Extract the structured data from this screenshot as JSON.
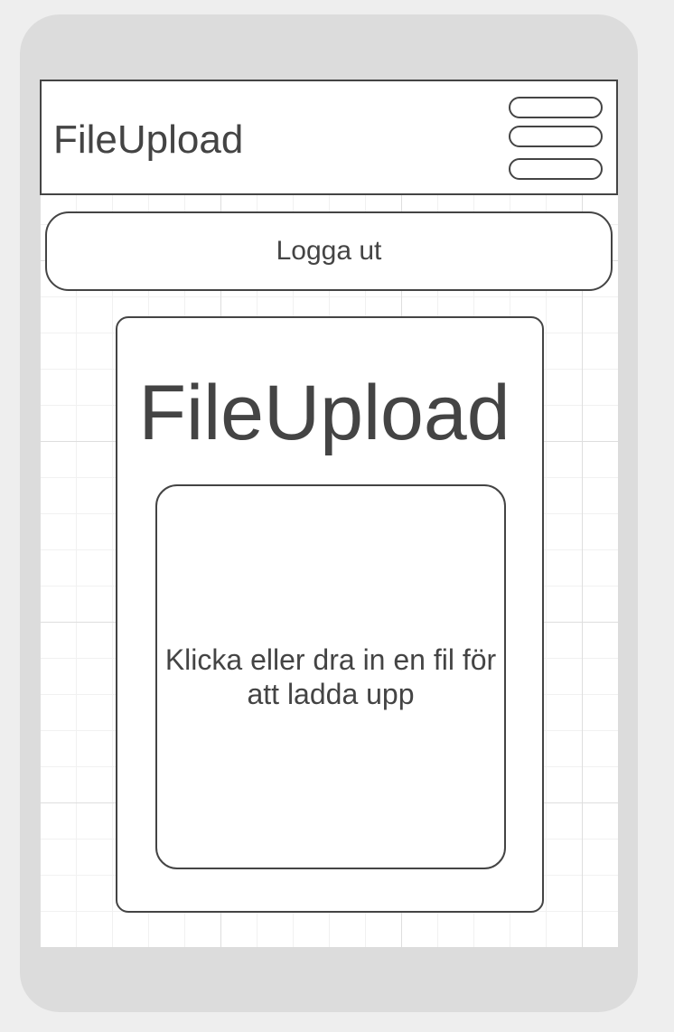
{
  "header": {
    "title": "FileUpload",
    "menu_icon": "hamburger-menu-icon"
  },
  "logout_button": {
    "label": "Logga ut"
  },
  "main": {
    "title": "FileUpload",
    "dropzone_text": "Klicka eller dra in en fil för att ladda upp"
  },
  "colors": {
    "frame": "#dcdcdc",
    "outline": "#444444",
    "text": "#444444",
    "grid_minor": "#f1f1f1",
    "grid_major": "#dedede"
  }
}
